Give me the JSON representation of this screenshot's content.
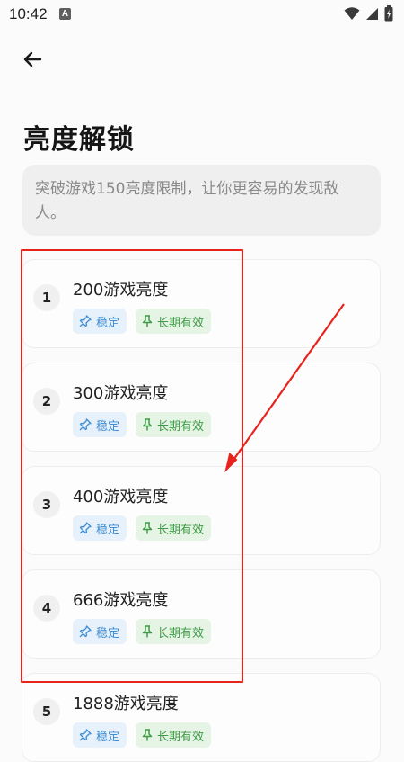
{
  "status_bar": {
    "time": "10:42",
    "notification_letter": "A"
  },
  "page": {
    "title": "亮度解锁",
    "description": "突破游戏150亮度限制，让你更容易的发现敌人。"
  },
  "items": [
    {
      "number": "1",
      "title": "200游戏亮度",
      "tags": [
        "稳定",
        "长期有效"
      ]
    },
    {
      "number": "2",
      "title": "300游戏亮度",
      "tags": [
        "稳定",
        "长期有效"
      ]
    },
    {
      "number": "3",
      "title": "400游戏亮度",
      "tags": [
        "稳定",
        "长期有效"
      ]
    },
    {
      "number": "4",
      "title": "666游戏亮度",
      "tags": [
        "稳定",
        "长期有效"
      ]
    },
    {
      "number": "5",
      "title": "1888游戏亮度",
      "tags": [
        "稳定",
        "长期有效"
      ]
    }
  ],
  "colors": {
    "annotation_red": "#e8231c",
    "stable_tag_bg": "#e6f1fb",
    "stable_tag_text": "#3e8ed6",
    "long_tag_bg": "#e6f4e6",
    "long_tag_text": "#3f9c46"
  },
  "icons": {
    "back": "arrow-left-icon",
    "stable_tag": "pin-icon",
    "long_tag": "pushpin-icon"
  }
}
